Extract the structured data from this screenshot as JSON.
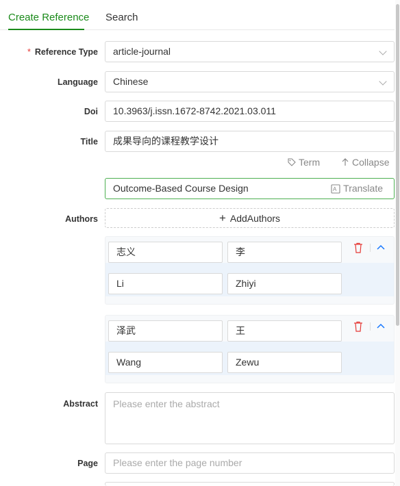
{
  "tabs": [
    {
      "label": "Create Reference",
      "active": true
    },
    {
      "label": "Search",
      "active": false
    }
  ],
  "fields": {
    "reference_type": {
      "label": "Reference Type",
      "required_mark": "*",
      "value": "article-journal"
    },
    "language": {
      "label": "Language",
      "value": "Chinese"
    },
    "doi": {
      "label": "Doi",
      "value": "10.3963/j.issn.1672-8742.2021.03.011"
    },
    "title": {
      "label": "Title",
      "value": "成果导向的课程教学设计"
    },
    "title_translation": "Outcome-Based Course Design",
    "authors_label": "Authors",
    "abstract": {
      "label": "Abstract",
      "placeholder": "Please enter the abstract"
    },
    "page": {
      "label": "Page",
      "placeholder": "Please enter the page number"
    }
  },
  "actions": {
    "term": "Term",
    "collapse": "Collapse",
    "translate": "Translate",
    "add_authors": "AddAuthors"
  },
  "authors": [
    {
      "given": "志义",
      "family": "李",
      "given_en": "Li",
      "family_en": "Zhiyi"
    },
    {
      "given": "泽武",
      "family": "王",
      "given_en": "Wang",
      "family_en": "Zewu"
    }
  ],
  "colors": {
    "accent": "#1a8a1a",
    "danger": "#e53935",
    "link": "#1677ff"
  }
}
